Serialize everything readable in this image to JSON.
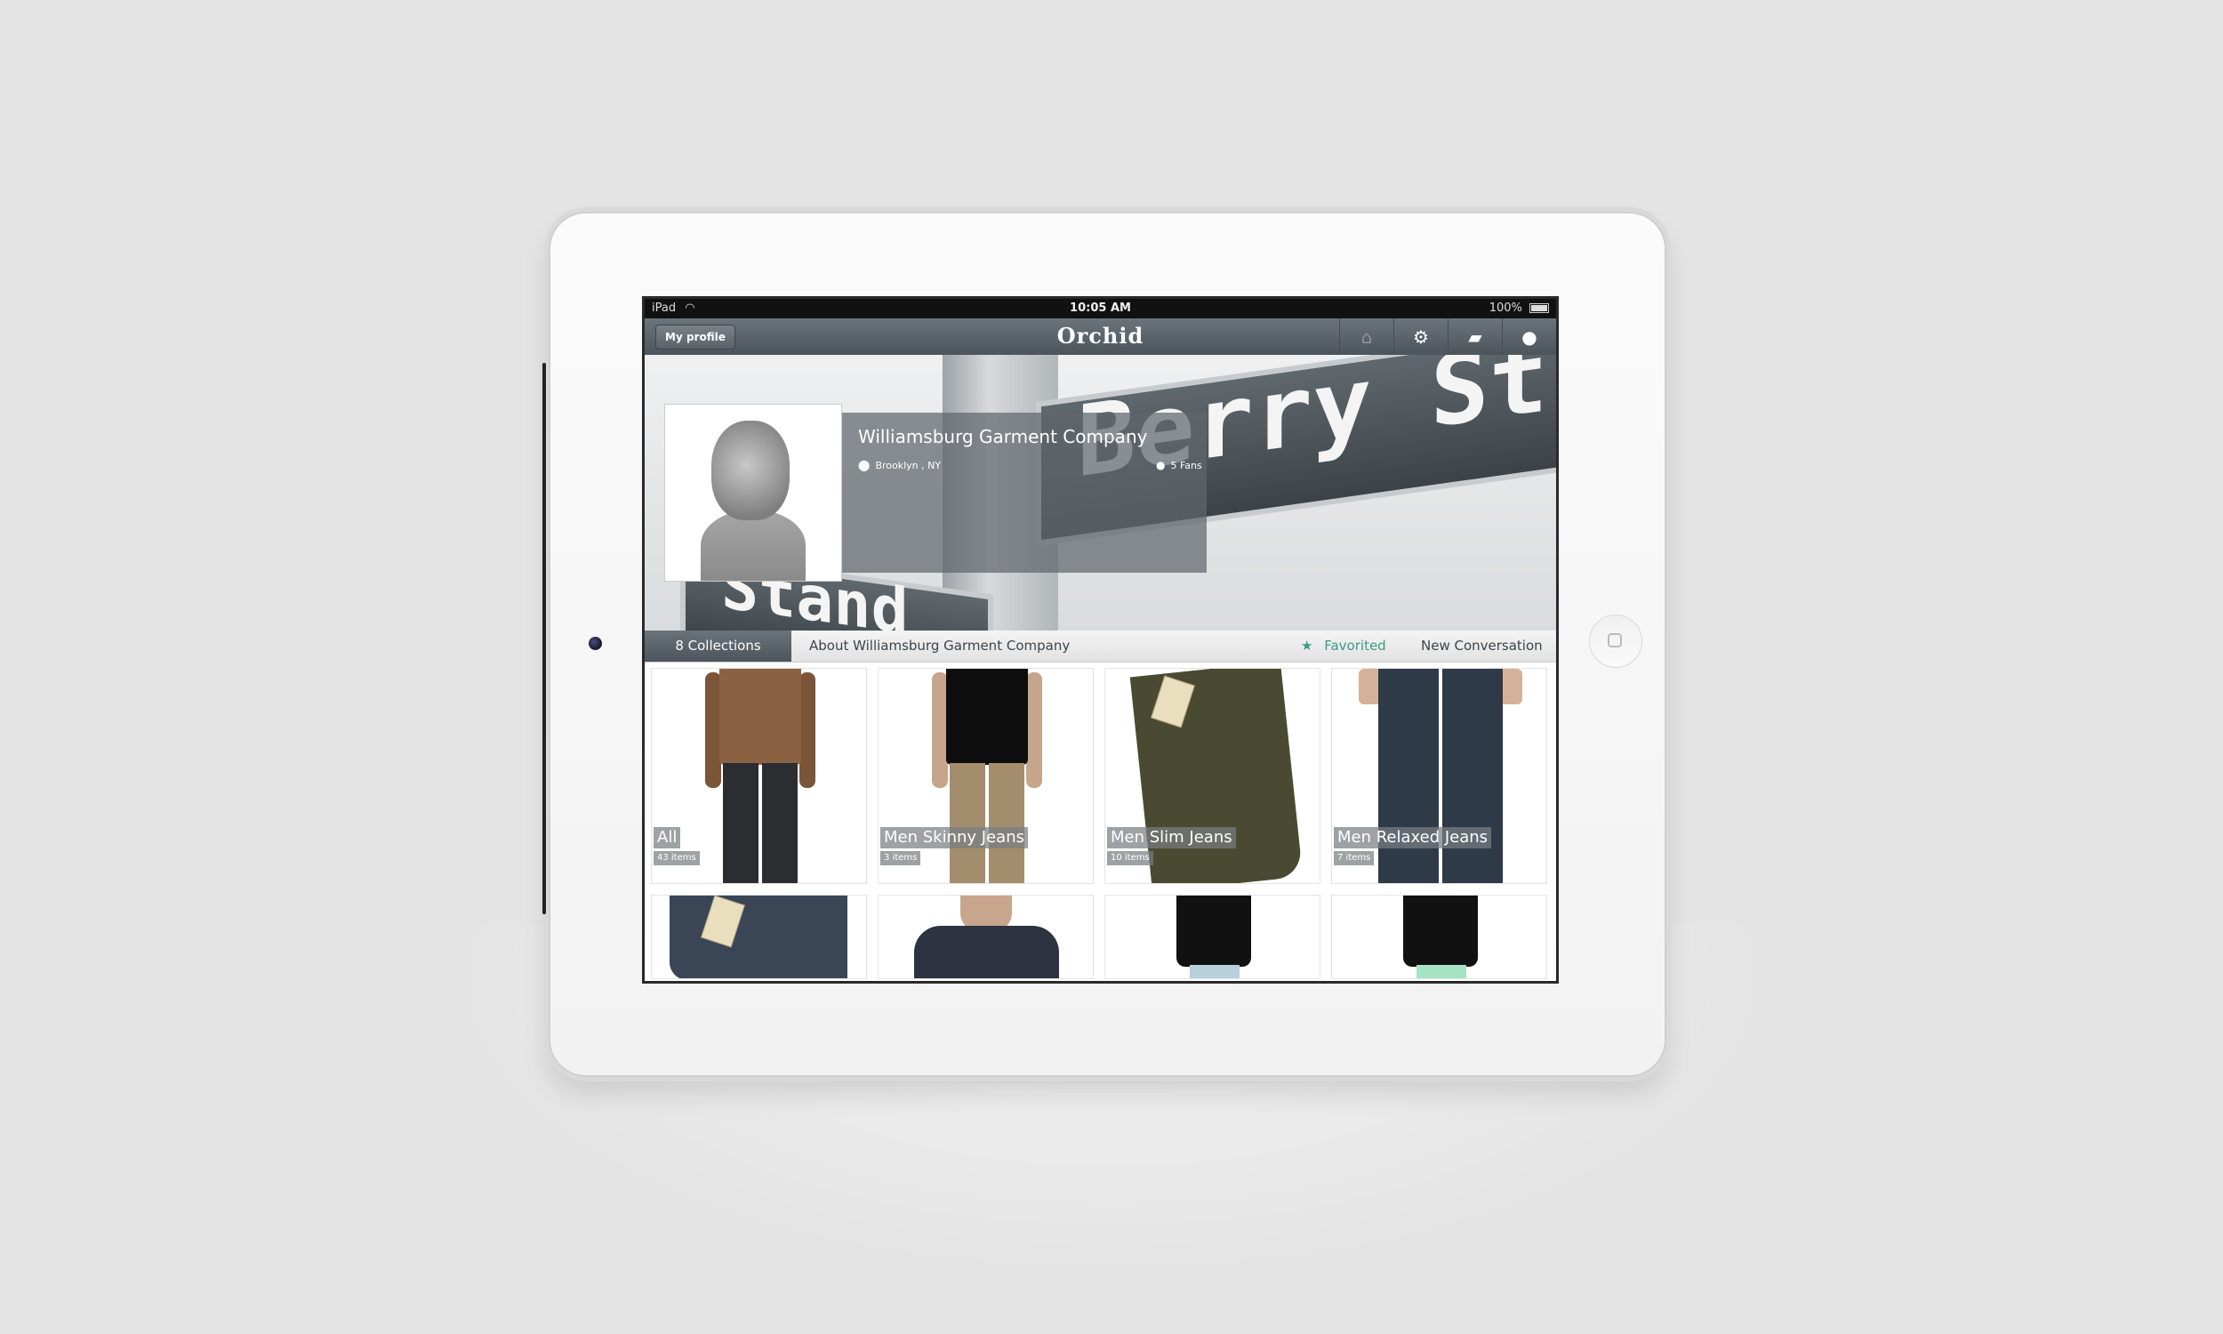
{
  "status_bar": {
    "device": "iPad",
    "time": "10:05 AM",
    "battery": "100%"
  },
  "nav": {
    "profile_button": "My profile",
    "logo": "Orchid",
    "icons": [
      "basket-icon",
      "gear-icon",
      "chat-icon",
      "user-icon"
    ]
  },
  "profile": {
    "name": "Williamsburg Garment Company",
    "location": "Brooklyn , NY",
    "fans": "5 Fans",
    "sign_text_main": "Berry St",
    "sign_text_secondary": "Stand St"
  },
  "tabs": {
    "collections": "8 Collections",
    "about": "About Williamsburg Garment Company",
    "favorited": "Favorited",
    "new_conversation": "New Conversation"
  },
  "collections": [
    {
      "title": "All",
      "count": "43 items"
    },
    {
      "title": "Men Skinny Jeans",
      "count": "3 items"
    },
    {
      "title": "Men Slim Jeans",
      "count": "10 items"
    },
    {
      "title": "Men Relaxed Jeans",
      "count": "7 items"
    }
  ],
  "colors": {
    "accent": "#3a9a83",
    "navbar": "#5a6268"
  }
}
